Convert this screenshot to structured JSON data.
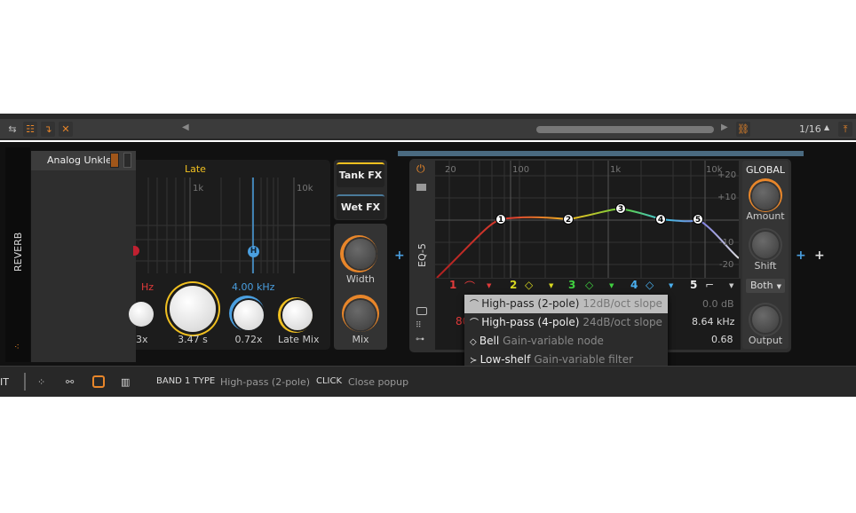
{
  "toolbar": {
    "zoom_value": "1/16",
    "icons": [
      "mixer-toggle-icon",
      "device-list-icon",
      "arrow-down-icon",
      "close-icon",
      "scroll-left-icon",
      "scroll-right-icon",
      "link-icon",
      "zoom-arrow-icon",
      "pin-icon"
    ]
  },
  "reverb": {
    "strip_label": "REVERB",
    "preset_name": "Analog Unkle",
    "late_label": "Late",
    "grid_labels": [
      "1k",
      "10k"
    ],
    "freq_low_unit": "Hz",
    "freq_high": "4.00 kHz",
    "handle_label": "H",
    "knobs": [
      "3x",
      "3.47 s",
      "0.72x",
      "Late Mix"
    ],
    "tank_fx": "Tank FX",
    "wet_fx": "Wet FX",
    "width_label": "Width",
    "mix_label": "Mix",
    "accent": "#f0c020",
    "blue": "#4a9fe0"
  },
  "eq": {
    "title": "EQ-5",
    "freq_labels": [
      "20",
      "100",
      "1k",
      "10k"
    ],
    "db_labels": [
      "+20",
      "+10",
      "-10",
      "-20"
    ],
    "bands": [
      {
        "num": "1",
        "color": "#e03a3a"
      },
      {
        "num": "2",
        "color": "#d8d820"
      },
      {
        "num": "3",
        "color": "#40d040"
      },
      {
        "num": "4",
        "color": "#4ab0f0"
      },
      {
        "num": "5",
        "color": "#eeeeee"
      }
    ],
    "nodes": [
      "1",
      "2",
      "3",
      "4",
      "5"
    ],
    "band_values": {
      "left_partial": "80",
      "gain": "0.0 dB",
      "freq": "8.64 kHz",
      "q": "0.68"
    },
    "global": {
      "title": "GLOBAL",
      "amount": "Amount",
      "shift": "Shift",
      "mode": "Both",
      "output": "Output"
    }
  },
  "popup": {
    "items": [
      {
        "label": "High-pass (2-pole)",
        "desc": "12dB/oct slope",
        "selected": true
      },
      {
        "label": "High-pass (4-pole)",
        "desc": "24dB/oct slope"
      },
      {
        "label": "Bell",
        "desc": "Gain-variable node"
      },
      {
        "label": "Low-shelf",
        "desc": "Gain-variable filter"
      }
    ]
  },
  "footer": {
    "partial": "IT",
    "hint1_key": "BAND 1 TYPE",
    "hint1_val": "High-pass (2-pole)",
    "hint2_key": "CLICK",
    "hint2_val": "Close popup"
  }
}
